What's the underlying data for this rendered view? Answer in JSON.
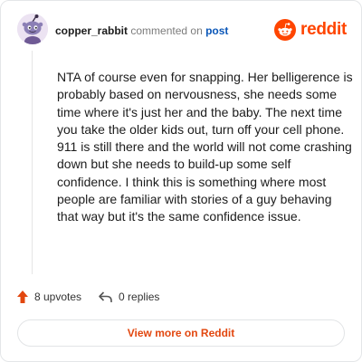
{
  "colors": {
    "reddit_orange": "#ff4500",
    "link_blue": "#0b57b8"
  },
  "header": {
    "username": "copper_rabbit",
    "action": "commented on",
    "target": "post",
    "logo_text": "reddit",
    "avatar_icon": "snoo-avatar-icon"
  },
  "comment": {
    "text": "NTA of course even for snapping. Her belligerence is probably based on nervousness, she needs some time where it's just her and the baby. The next time you take the older kids out, turn off your cell phone. 911 is still there and the world will not come crashing down but she needs to build-up some self confidence. I think this is something where most people are familiar with stories of a guy behaving that way but it's the same confidence issue."
  },
  "footer": {
    "upvotes": "8 upvotes",
    "replies": "0 replies",
    "upvote_icon": "upvote-arrow-icon",
    "reply_icon": "reply-arrow-icon"
  },
  "button": {
    "view_more": "View more on Reddit"
  }
}
